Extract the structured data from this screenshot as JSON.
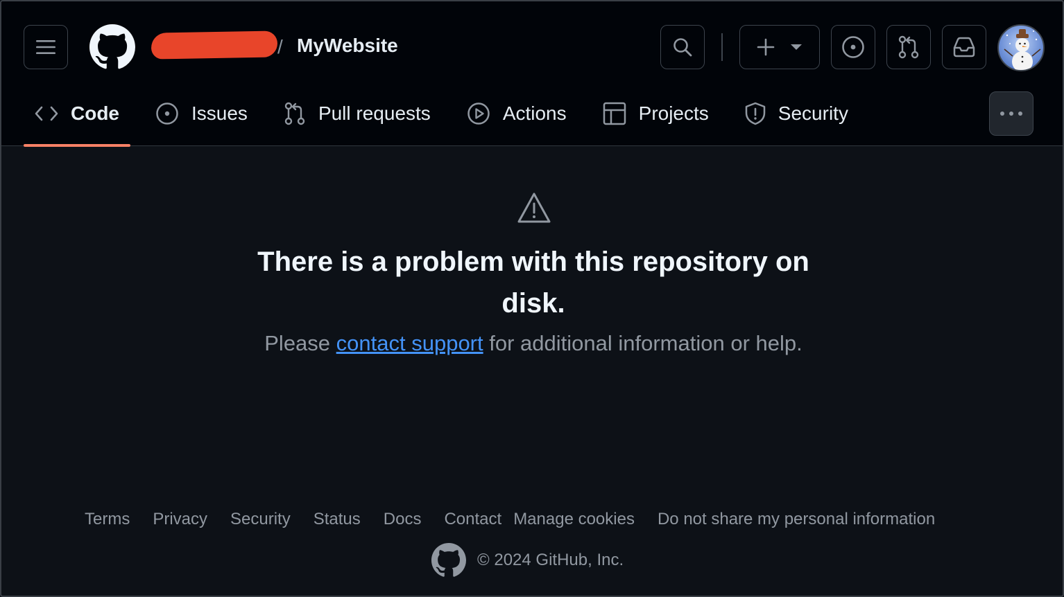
{
  "header": {
    "repo_slash": "/",
    "repo_name": "MyWebsite"
  },
  "tabs": [
    {
      "label": "Code",
      "icon": "code-icon",
      "active": true
    },
    {
      "label": "Issues",
      "icon": "issue-opened-icon"
    },
    {
      "label": "Pull requests",
      "icon": "git-pull-request-icon"
    },
    {
      "label": "Actions",
      "icon": "play-icon"
    },
    {
      "label": "Projects",
      "icon": "table-icon"
    },
    {
      "label": "Security",
      "icon": "shield-icon"
    }
  ],
  "main": {
    "title": "There is a problem with this repository on disk.",
    "message_prefix": "Please ",
    "link_text": "contact support",
    "message_suffix": " for additional information or help."
  },
  "footer": {
    "links": [
      "Terms",
      "Privacy",
      "Security",
      "Status",
      "Docs",
      "Contact",
      "Manage cookies",
      "Do not share my personal information"
    ],
    "copyright": "© 2024 GitHub, Inc."
  },
  "colors": {
    "background": "#0d1117",
    "header_bg": "#010409",
    "active_tab_underline": "#f78166",
    "link": "#4493f8",
    "redaction": "#e8452a"
  }
}
